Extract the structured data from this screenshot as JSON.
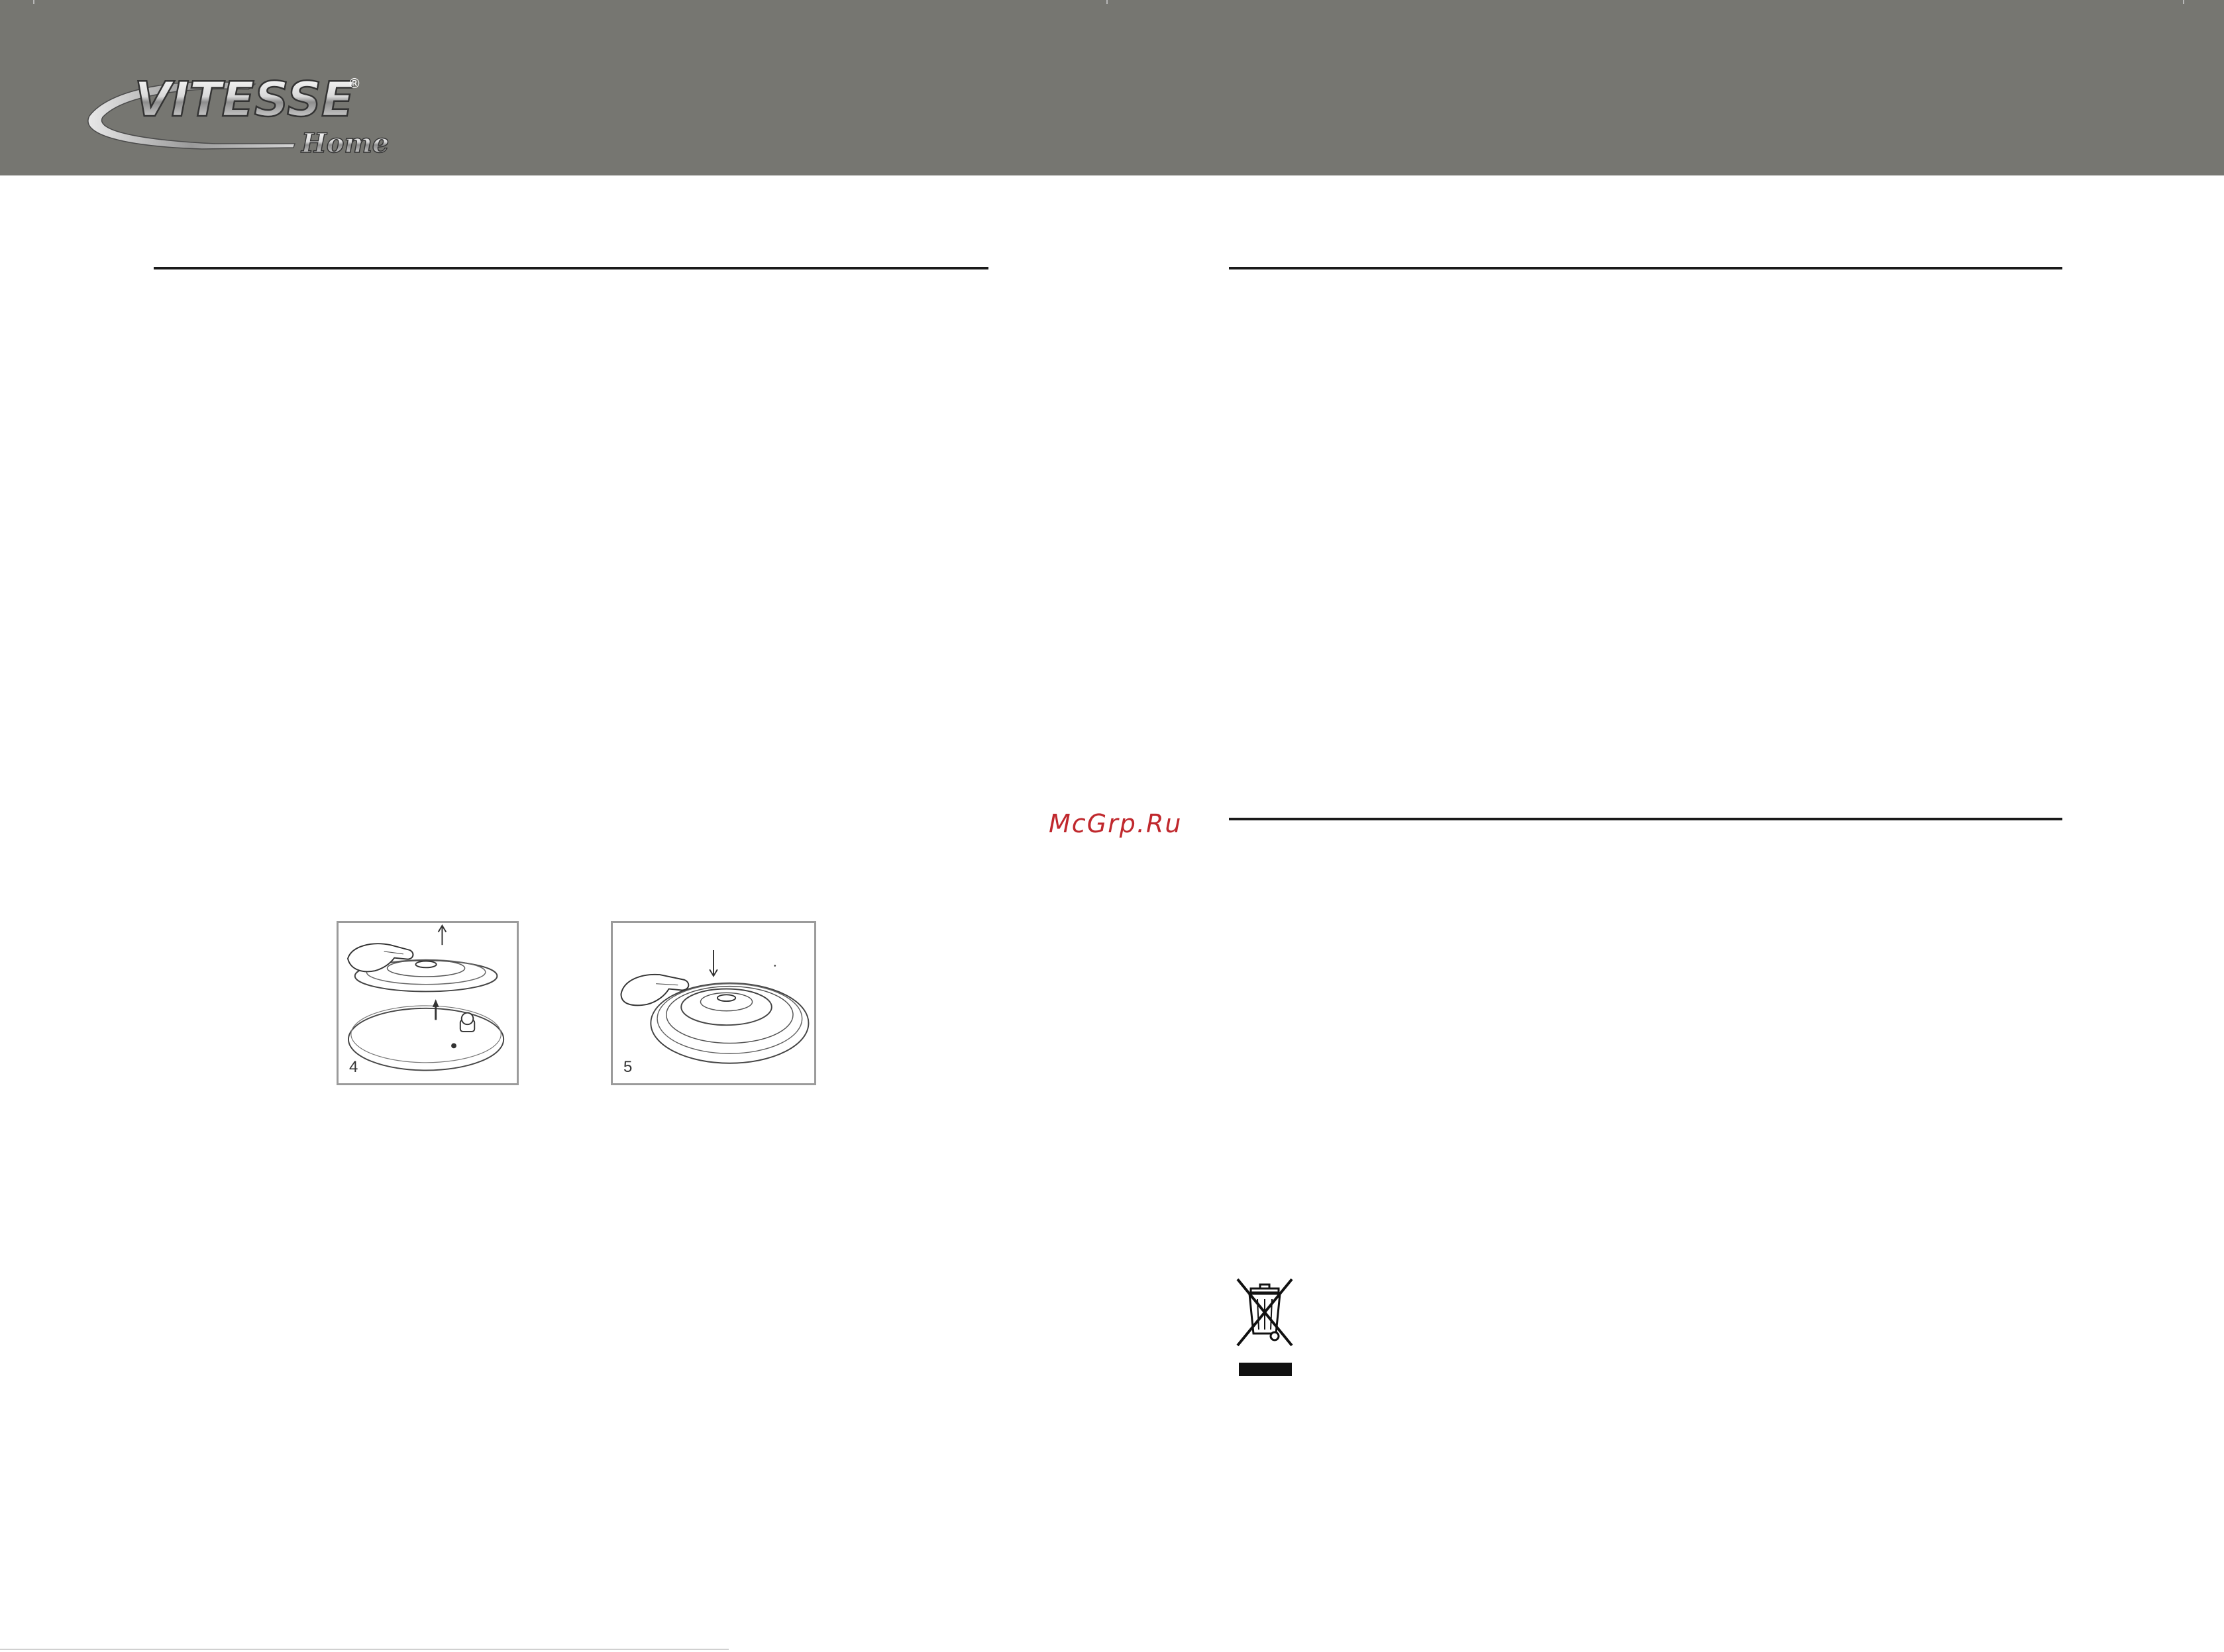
{
  "header": {
    "brand_name": "VITESSE",
    "brand_sub": "Home",
    "registered_mark": "®",
    "band_color": "#767671"
  },
  "watermark": {
    "text": "McGrp.Ru",
    "color": "#c0282d"
  },
  "figures": [
    {
      "number": "4",
      "icon": "lid-lift-up-illustration"
    },
    {
      "number": "5",
      "icon": "lid-press-down-illustration"
    }
  ],
  "recycle_symbol": {
    "icon": "crossed-out-wheelie-bin-icon"
  }
}
